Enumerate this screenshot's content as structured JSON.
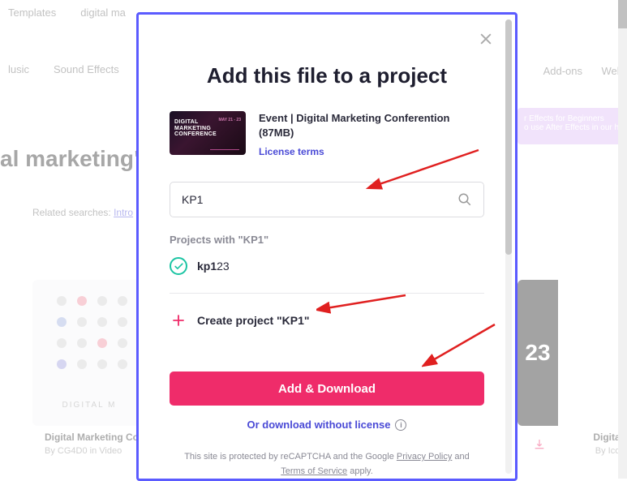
{
  "bg": {
    "nav1": [
      "Templates",
      "digital ma"
    ],
    "nav2": [
      "lusic",
      "Sound Effects"
    ],
    "heading": "al marketing\"",
    "related_label": "Related searches:",
    "related_link": "Intro",
    "card1_label": "DIGITAL M",
    "card1_title": "Digital Marketing Co",
    "card1_sub": "By CG4D0 in Video",
    "card2_text": "23",
    "card2_title": "Digital",
    "card2_sub": "By Icor",
    "addons": "Add-ons",
    "web": "Web",
    "promo1": "r Effects for Beginners",
    "promo2": "o use After Effects in our h"
  },
  "modal": {
    "title": "Add this file to a project",
    "thumb_line1": "DIGITAL",
    "thumb_line2": "MARKETING",
    "thumb_line3": "CONFERENCE",
    "thumb_date": "MAY 21 - 23",
    "file_name": "Event | Digital Marketing Conferention (87MB)",
    "license_terms": "License terms",
    "search_value": "KP1",
    "projects_label": "Projects with \"KP1\"",
    "project_match_prefix": "kp1",
    "project_match_rest": "23",
    "create_prefix": "Create project \"",
    "create_name": "KP1",
    "create_suffix": "\"",
    "btn_primary": "Add & Download",
    "alt_download": "Or download without license",
    "legal_pre": "This site is protected by reCAPTCHA and the Google ",
    "legal_pp": "Privacy Policy",
    "legal_mid": " and ",
    "legal_tos": "Terms of Service",
    "legal_post": " apply."
  }
}
